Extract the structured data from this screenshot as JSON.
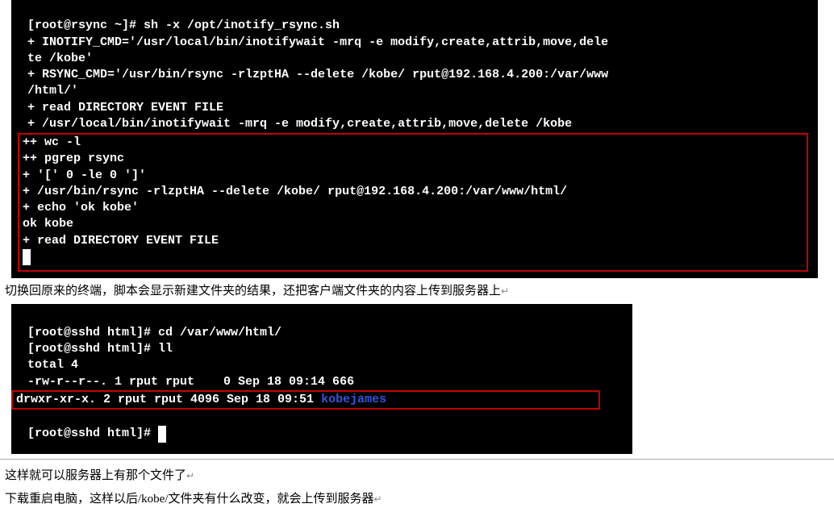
{
  "term1": {
    "l1": "[root@rsync ~]# sh -x /opt/inotify_rsync.sh",
    "l2": "+ INOTIFY_CMD='/usr/local/bin/inotifywait -mrq -e modify,create,attrib,move,dele",
    "l3": "te /kobe'",
    "l4": "+ RSYNC_CMD='/usr/bin/rsync -rlzptHA --delete /kobe/ rput@192.168.4.200:/var/www",
    "l5": "/html/'",
    "l6": "+ read DIRECTORY EVENT FILE",
    "l7": "+ /usr/local/bin/inotifywait -mrq -e modify,create,attrib,move,delete /kobe",
    "box": {
      "b1": "++ wc -l",
      "b2": "++ pgrep rsync",
      "b3": "+ '[' 0 -le 0 ']'",
      "b4": "+ /usr/bin/rsync -rlzptHA --delete /kobe/ rput@192.168.4.200:/var/www/html/",
      "b5": "+ echo 'ok kobe'",
      "b6": "ok kobe",
      "b7": "+ read DIRECTORY EVENT FILE"
    }
  },
  "doc1": "切换回原来的终端，脚本会显示新建文件夹的结果，还把客户端文件夹的内容上传到服务器上",
  "term2": {
    "l1": "[root@sshd html]# cd /var/www/html/",
    "l2": "[root@sshd html]# ll",
    "l3": "total 4",
    "l4": "-rw-r--r--. 1 rput rput    0 Sep 18 09:14 666",
    "box_pre": "drwxr-xr-x. 2 rput rput 4096 Sep 18 09:51 ",
    "box_dir": "kobejames",
    "l6": "[root@sshd html]# "
  },
  "doc2": "这样就可以服务器上有那个文件了",
  "doc3": "下载重启电脑，这样以后/kobe/文件夹有什么改变，就会上传到服务器"
}
